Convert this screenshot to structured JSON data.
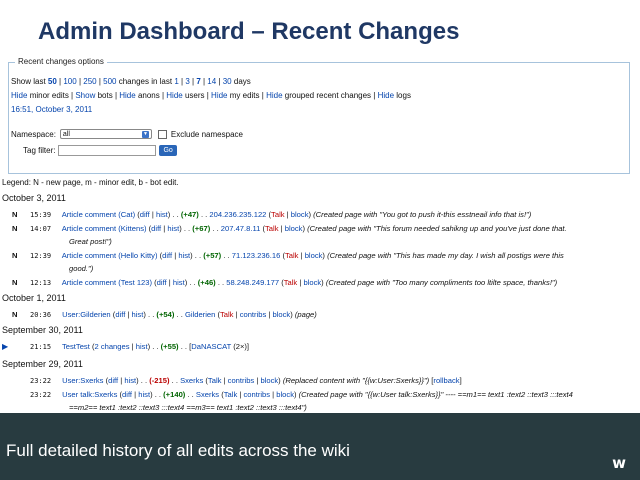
{
  "slide": {
    "title": "Admin Dashboard – Recent Changes",
    "caption": "Full detailed history of all edits across the wiki",
    "logo": "w"
  },
  "options": {
    "legend": "Recent changes options",
    "line1": {
      "show_last": "Show last",
      "counts": [
        "50",
        "100",
        "250",
        "500"
      ],
      "changes_in_last": "changes in last",
      "days": [
        "1",
        "3",
        "7",
        "14",
        "30"
      ],
      "days_label": "days"
    },
    "line2": [
      {
        "action": "Hide",
        "label": "minor edits"
      },
      {
        "action": "Show",
        "label": "bots"
      },
      {
        "action": "Hide",
        "label": "anons"
      },
      {
        "action": "Hide",
        "label": "users"
      },
      {
        "action": "Hide",
        "label": "my edits"
      },
      {
        "action": "Hide",
        "label": "grouped recent changes"
      },
      {
        "action": "Hide",
        "label": "logs"
      }
    ],
    "timestamp_link": "16:51, October 3, 2011",
    "namespace_label": "Namespace:",
    "namespace_value": "all",
    "exclude_label": "Exclude namespace",
    "tag_filter_label": "Tag filter:",
    "go_label": "Go"
  },
  "legend_text": "Legend: N - new page, m - minor edit, b - bot edit.",
  "days": [
    {
      "date": "October 3, 2011",
      "entries": [
        {
          "flag": "N",
          "time": "15:39",
          "title": "Article comment (Cat)",
          "diff": "diff",
          "hist": "hist",
          "delta": "(+47)",
          "user": "204.236.235.122",
          "talk": "Talk",
          "block": "block",
          "summary": "(Created page with \"You got to push it-this esstneail info that is!\")",
          "continuation": ""
        },
        {
          "flag": "N",
          "time": "14:07",
          "title": "Article comment (Kittens)",
          "diff": "diff",
          "hist": "hist",
          "delta": "(+67)",
          "user": "207.47.8.11",
          "talk": "Talk",
          "block": "block",
          "summary": "(Created page with \"This forum needed sahikng up and you've just done that.",
          "continuation": "Great post!\")"
        },
        {
          "flag": "N",
          "time": "12:39",
          "title": "Article comment (Hello Kitty)",
          "diff": "diff",
          "hist": "hist",
          "delta": "(+57)",
          "user": "71.123.236.16",
          "talk": "Talk",
          "block": "block",
          "summary": "(Created page with \"This has made my day. I wish all postigs were this",
          "continuation": "good.\")"
        },
        {
          "flag": "N",
          "time": "12:13",
          "title": "Article comment (Test 123)",
          "diff": "diff",
          "hist": "hist",
          "delta": "(+46)",
          "user": "58.248.249.177",
          "talk": "Talk",
          "block": "block",
          "summary": "(Created page with \"Too many compliments too ltilte space, thanks!\")",
          "continuation": ""
        }
      ]
    },
    {
      "date": "October 1, 2011",
      "entries": [
        {
          "flag": "N",
          "time": "20:36",
          "title": "User:Gilderien",
          "diff": "diff",
          "hist": "hist",
          "delta": "(+54)",
          "user": "Gilderien",
          "talk": "Talk",
          "contribs": "contribs",
          "block": "block",
          "summary": "(page)"
        }
      ]
    },
    {
      "date": "September 30, 2011",
      "entries": [
        {
          "flag": "▶",
          "time": "21:15",
          "title": "TestTest",
          "changes": "2 changes",
          "hist": "hist",
          "delta": "(+55)",
          "user": "DaNASCAT",
          "count": "(2×)"
        }
      ]
    },
    {
      "date": "September 29, 2011",
      "entries": [
        {
          "flag": "",
          "time": "23:22",
          "title": "User:Sxerks",
          "diff": "diff",
          "hist": "hist",
          "delta": "(-215)",
          "user": "Sxerks",
          "talk": "Talk",
          "contribs": "contribs",
          "block": "block",
          "summary": "(Replaced content with \"{{w:User:Sxerks}}\")",
          "rollback": "rollback"
        },
        {
          "flag": "",
          "time": "23:22",
          "title": "User talk:Sxerks",
          "diff": "diff",
          "hist": "hist",
          "delta": "(+140)",
          "user": "Sxerks",
          "talk": "Talk",
          "contribs": "contribs",
          "block": "block",
          "summary": "(Created page with \"{{w:User talk:Sxerks}}\" ---- ==m1== text1 :text2 ::text3 :::text4",
          "continuation": "==m2== text1 :text2 ::text3 :::text4 ==m3== text1 :text2 ::text3 :::text4\")"
        }
      ]
    }
  ],
  "colors": {
    "title": "#1f3864",
    "link": "#0645ad",
    "red_link": "#ba0000",
    "positive": "#006400",
    "caption_bar": "#283b40"
  }
}
